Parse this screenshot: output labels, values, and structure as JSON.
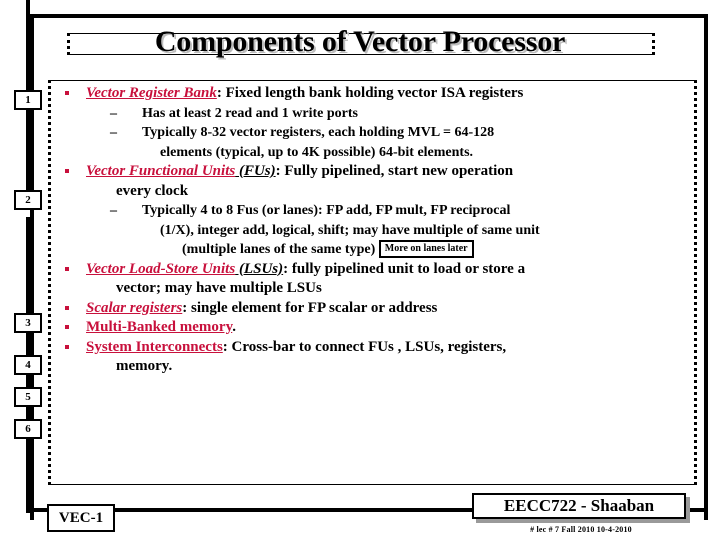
{
  "slide": {
    "title": "Components of Vector Processor",
    "footer": {
      "tag": "VEC-1",
      "course": "EECC722 - Shaaban",
      "meta": "#  lec # 7     Fall 2010    10-4-2010"
    },
    "accent_color": "#C8103C",
    "markers": [
      {
        "label": "1"
      },
      {
        "label": "2"
      },
      {
        "label": "3"
      },
      {
        "label": "4"
      },
      {
        "label": "5"
      },
      {
        "label": "6"
      }
    ],
    "bullets": [
      {
        "lead": "Vector Register Bank",
        "lead_style": "italic",
        "lead_suffix": ":",
        "rest": " Fixed length bank holding vector ISA registers",
        "sub": [
          {
            "text": "Has at least 2 read and 1 write ports"
          },
          {
            "text": "Typically 8-32 vector registers, each holding MVL = 64-128",
            "cont": "elements (typical, up to 4K possible)   64-bit elements."
          }
        ]
      },
      {
        "lead": "Vector Functional Units",
        "lead_style": "italic",
        "lead_paren": " (FUs)",
        "lead_suffix": ":",
        "rest": " Fully pipelined, start new operation",
        "cont_l1": "every clock",
        "sub": [
          {
            "text": "Typically 4 to 8 Fus (or lanes): FP add, FP mult, FP reciprocal",
            "cont": "(1/X),        integer add, logical,  shift; may have multiple of same unit",
            "cont2": "(multiple lanes of the same type)",
            "callout": "More on lanes later"
          }
        ]
      },
      {
        "lead": "Vector Load-Store Units",
        "lead_style": "italic",
        "lead_paren": " (LSUs)",
        "lead_suffix": ":",
        "rest": " fully pipelined unit to load or store a",
        "cont_l1": "vector; may have multiple LSUs",
        "sub": []
      },
      {
        "lead": "Scalar registers",
        "lead_style": "italic",
        "lead_suffix": ":",
        "rest": " single element for FP scalar or address",
        "sub": []
      },
      {
        "lead": "Multi-Banked memory",
        "lead_style": "upright",
        "lead_suffix": ".",
        "rest": "",
        "sub": []
      },
      {
        "lead": "System Interconnects",
        "lead_style": "upright",
        "lead_suffix": ":",
        "rest": " Cross-bar to connect FUs , LSUs, registers,",
        "cont_l1": "memory.",
        "sub": []
      }
    ]
  }
}
